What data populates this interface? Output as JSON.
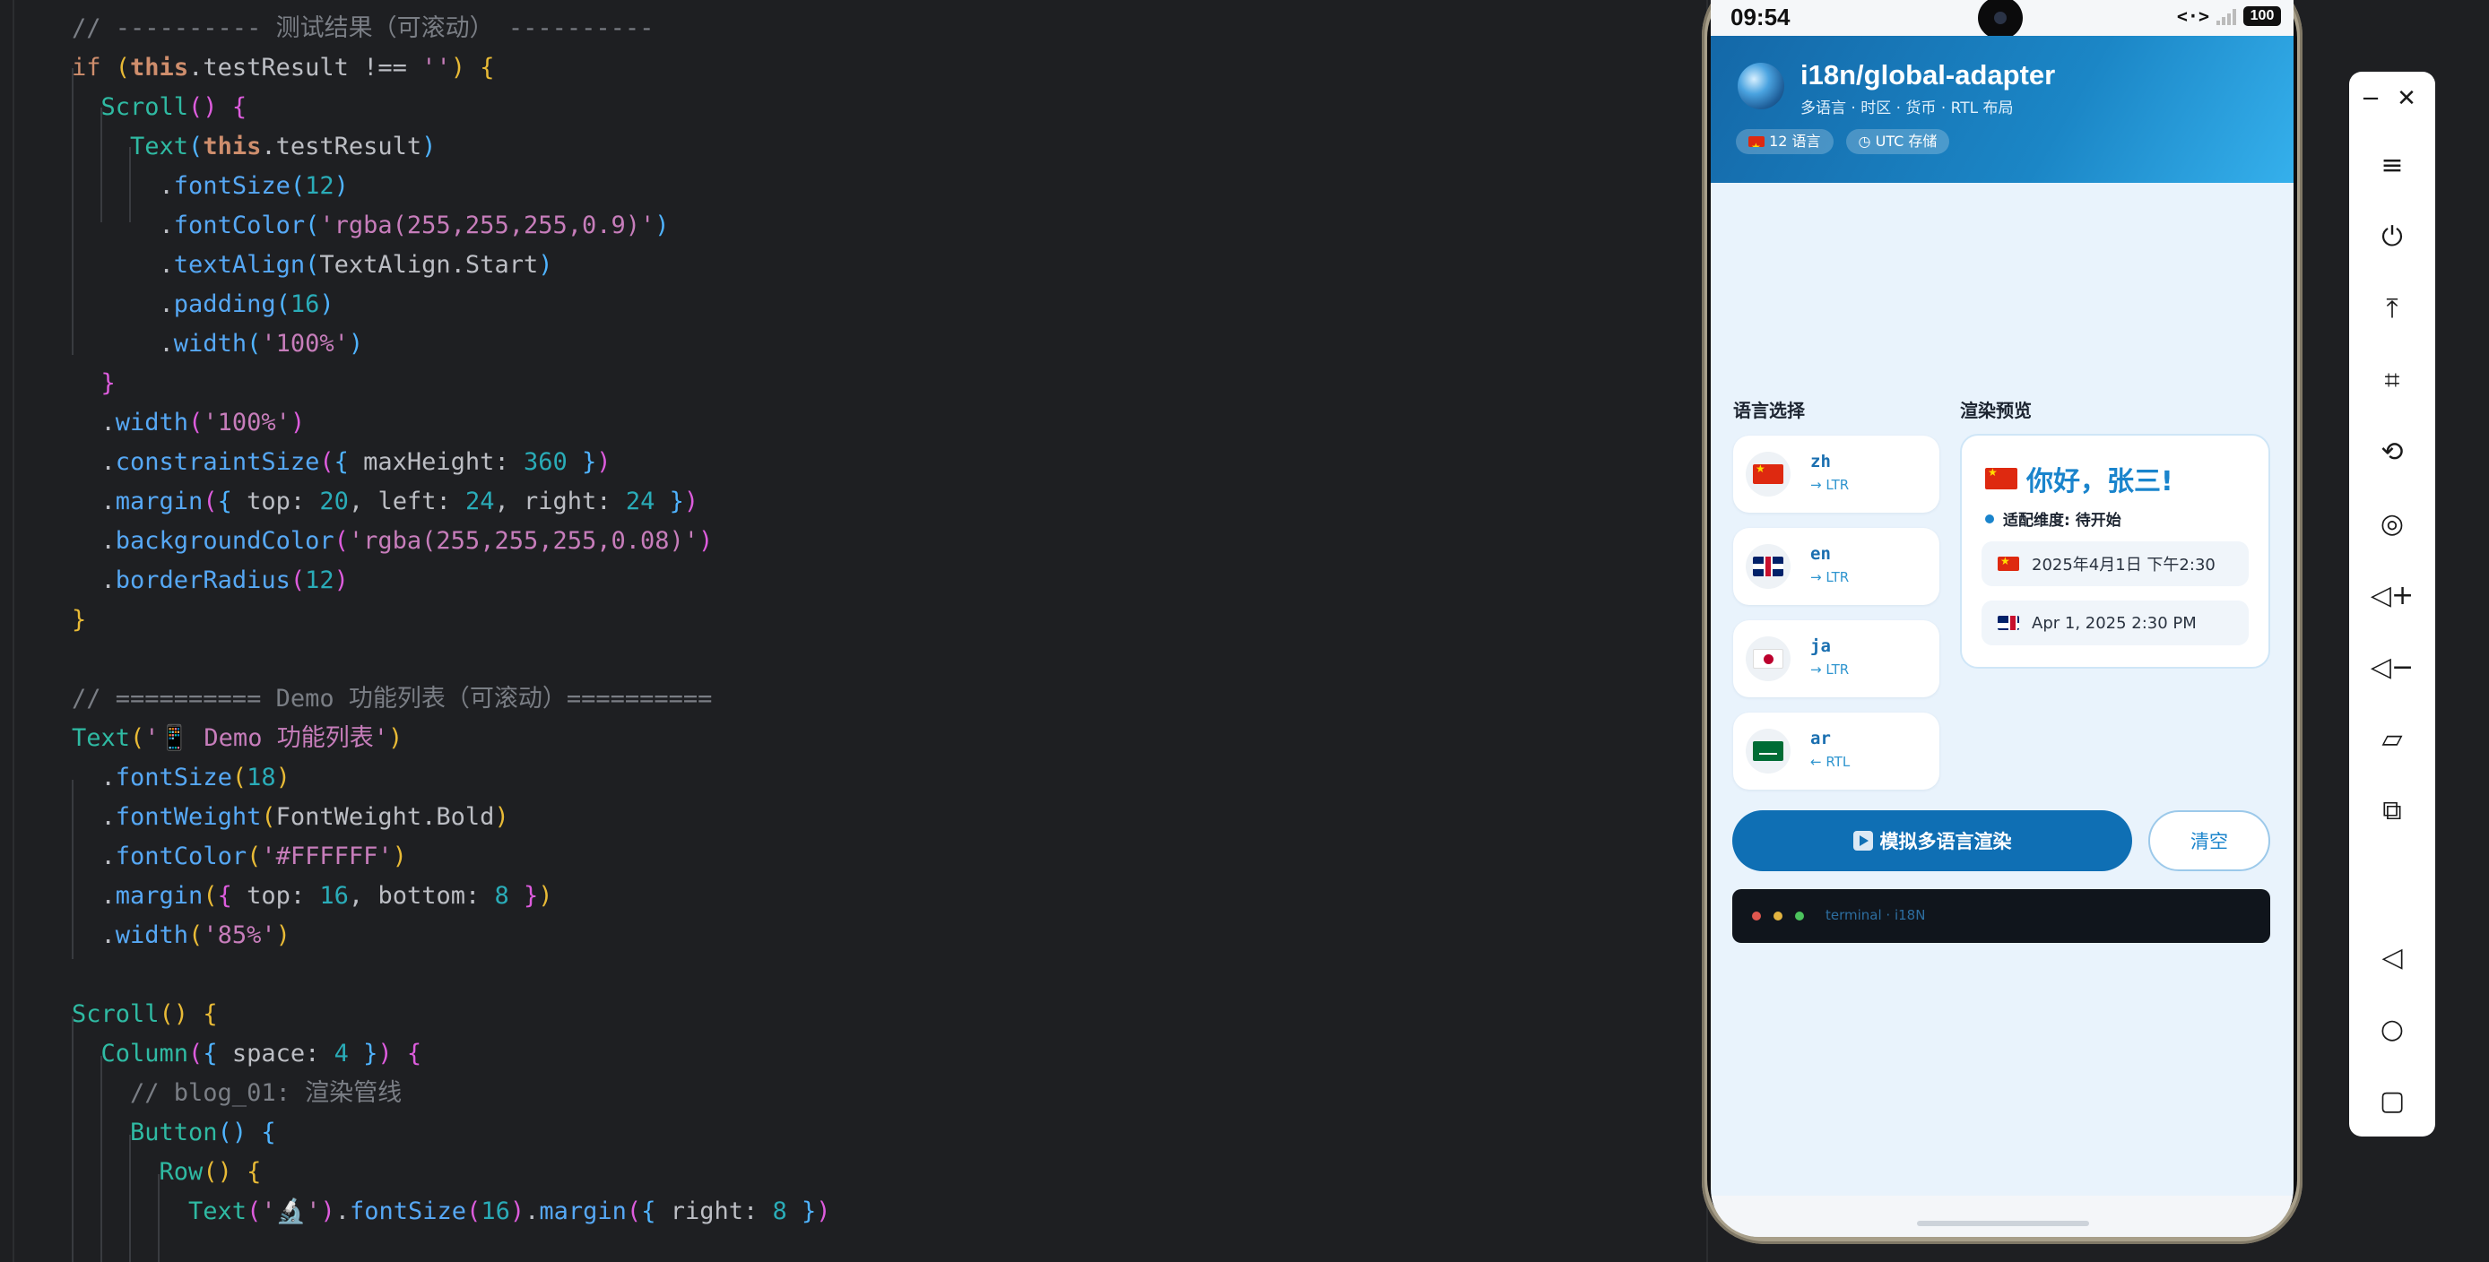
{
  "editor": {
    "lines": [
      [
        [
          "t-cm",
          "// ---------- 测试结果（可滚动） ----------"
        ]
      ],
      [
        [
          "t-kw",
          "if "
        ],
        [
          "t-p1",
          "("
        ],
        [
          "t-this",
          "this"
        ],
        [
          "t-ct",
          "."
        ],
        [
          "t-id",
          "testResult "
        ],
        [
          "t-ct",
          "!== "
        ],
        [
          "t-str",
          "''"
        ],
        [
          "t-p1",
          ") {"
        ]
      ],
      [
        [
          "t-comp",
          "  Scroll"
        ],
        [
          "t-p2",
          "() {"
        ]
      ],
      [
        [
          "t-comp",
          "    Text"
        ],
        [
          "t-p3",
          "("
        ],
        [
          "t-this",
          "this"
        ],
        [
          "t-ct",
          "."
        ],
        [
          "t-id",
          "testResult"
        ],
        [
          "t-p3",
          ")"
        ]
      ],
      [
        [
          "t-ct",
          "      ."
        ],
        [
          "t-fn",
          "fontSize"
        ],
        [
          "t-p3",
          "("
        ],
        [
          "t-num",
          "12"
        ],
        [
          "t-p3",
          ")"
        ]
      ],
      [
        [
          "t-ct",
          "      ."
        ],
        [
          "t-fn",
          "fontColor"
        ],
        [
          "t-p3",
          "("
        ],
        [
          "t-str",
          "'rgba(255,255,255,0.9)'"
        ],
        [
          "t-p3",
          ")"
        ]
      ],
      [
        [
          "t-ct",
          "      ."
        ],
        [
          "t-fn",
          "textAlign"
        ],
        [
          "t-p3",
          "("
        ],
        [
          "t-id",
          "TextAlign.Start"
        ],
        [
          "t-p3",
          ")"
        ]
      ],
      [
        [
          "t-ct",
          "      ."
        ],
        [
          "t-fn",
          "padding"
        ],
        [
          "t-p3",
          "("
        ],
        [
          "t-num",
          "16"
        ],
        [
          "t-p3",
          ")"
        ]
      ],
      [
        [
          "t-ct",
          "      ."
        ],
        [
          "t-fn",
          "width"
        ],
        [
          "t-p3",
          "("
        ],
        [
          "t-str",
          "'100%'"
        ],
        [
          "t-p3",
          ")"
        ]
      ],
      [
        [
          "t-p2",
          "  }"
        ]
      ],
      [
        [
          "t-ct",
          "  ."
        ],
        [
          "t-fn",
          "width"
        ],
        [
          "t-p2",
          "("
        ],
        [
          "t-str",
          "'100%'"
        ],
        [
          "t-p2",
          ")"
        ]
      ],
      [
        [
          "t-ct",
          "  ."
        ],
        [
          "t-fn",
          "constraintSize"
        ],
        [
          "t-p2",
          "("
        ],
        [
          "t-p3",
          "{ "
        ],
        [
          "t-id",
          "maxHeight"
        ],
        [
          "t-ct",
          ": "
        ],
        [
          "t-num",
          "360"
        ],
        [
          "t-p3",
          " }"
        ],
        [
          "t-p2",
          ")"
        ]
      ],
      [
        [
          "t-ct",
          "  ."
        ],
        [
          "t-fn",
          "margin"
        ],
        [
          "t-p2",
          "("
        ],
        [
          "t-p3",
          "{ "
        ],
        [
          "t-id",
          "top"
        ],
        [
          "t-ct",
          ": "
        ],
        [
          "t-num",
          "20"
        ],
        [
          "t-ct",
          ", "
        ],
        [
          "t-id",
          "left"
        ],
        [
          "t-ct",
          ": "
        ],
        [
          "t-num",
          "24"
        ],
        [
          "t-ct",
          ", "
        ],
        [
          "t-id",
          "right"
        ],
        [
          "t-ct",
          ": "
        ],
        [
          "t-num",
          "24"
        ],
        [
          "t-p3",
          " }"
        ],
        [
          "t-p2",
          ")"
        ]
      ],
      [
        [
          "t-ct",
          "  ."
        ],
        [
          "t-fn",
          "backgroundColor"
        ],
        [
          "t-p2",
          "("
        ],
        [
          "t-str",
          "'rgba(255,255,255,0.08)'"
        ],
        [
          "t-p2",
          ")"
        ]
      ],
      [
        [
          "t-ct",
          "  ."
        ],
        [
          "t-fn",
          "borderRadius"
        ],
        [
          "t-p2",
          "("
        ],
        [
          "t-num",
          "12"
        ],
        [
          "t-p2",
          ")"
        ]
      ],
      [
        [
          "t-p1",
          "}"
        ]
      ],
      [
        [
          "t-ct",
          ""
        ]
      ],
      [
        [
          "t-cm",
          "// ========== Demo 功能列表（可滚动）=========="
        ]
      ],
      [
        [
          "t-comp",
          "Text"
        ],
        [
          "t-p1",
          "("
        ],
        [
          "t-str",
          "'📱 Demo 功能列表'"
        ],
        [
          "t-p1",
          ")"
        ]
      ],
      [
        [
          "t-ct",
          "  ."
        ],
        [
          "t-fn",
          "fontSize"
        ],
        [
          "t-p1",
          "("
        ],
        [
          "t-num",
          "18"
        ],
        [
          "t-p1",
          ")"
        ]
      ],
      [
        [
          "t-ct",
          "  ."
        ],
        [
          "t-fn",
          "fontWeight"
        ],
        [
          "t-p1",
          "("
        ],
        [
          "t-id",
          "FontWeight.Bold"
        ],
        [
          "t-p1",
          ")"
        ]
      ],
      [
        [
          "t-ct",
          "  ."
        ],
        [
          "t-fn",
          "fontColor"
        ],
        [
          "t-p1",
          "("
        ],
        [
          "t-str",
          "'#FFFFFF'"
        ],
        [
          "t-p1",
          ")"
        ]
      ],
      [
        [
          "t-ct",
          "  ."
        ],
        [
          "t-fn",
          "margin"
        ],
        [
          "t-p1",
          "("
        ],
        [
          "t-p2",
          "{ "
        ],
        [
          "t-id",
          "top"
        ],
        [
          "t-ct",
          ": "
        ],
        [
          "t-num",
          "16"
        ],
        [
          "t-ct",
          ", "
        ],
        [
          "t-id",
          "bottom"
        ],
        [
          "t-ct",
          ": "
        ],
        [
          "t-num",
          "8"
        ],
        [
          "t-p2",
          " }"
        ],
        [
          "t-p1",
          ")"
        ]
      ],
      [
        [
          "t-ct",
          "  ."
        ],
        [
          "t-fn",
          "width"
        ],
        [
          "t-p1",
          "("
        ],
        [
          "t-str",
          "'85%'"
        ],
        [
          "t-p1",
          ")"
        ]
      ],
      [
        [
          "t-ct",
          ""
        ]
      ],
      [
        [
          "t-comp",
          "Scroll"
        ],
        [
          "t-p1",
          "() {"
        ]
      ],
      [
        [
          "t-comp",
          "  Column"
        ],
        [
          "t-p2",
          "("
        ],
        [
          "t-p3",
          "{ "
        ],
        [
          "t-id",
          "space"
        ],
        [
          "t-ct",
          ": "
        ],
        [
          "t-num",
          "4"
        ],
        [
          "t-p3",
          " }"
        ],
        [
          "t-p2",
          ") {"
        ]
      ],
      [
        [
          "t-cm",
          "    // blog_01: 渲染管线"
        ]
      ],
      [
        [
          "t-comp",
          "    Button"
        ],
        [
          "t-p3",
          "() {"
        ]
      ],
      [
        [
          "t-comp",
          "      Row"
        ],
        [
          "t-p1",
          "() {"
        ]
      ],
      [
        [
          "t-comp",
          "        Text"
        ],
        [
          "t-p2",
          "("
        ],
        [
          "t-str",
          "'🔬'"
        ],
        [
          "t-p2",
          ")"
        ],
        [
          "t-ct",
          "."
        ],
        [
          "t-fn",
          "fontSize"
        ],
        [
          "t-p2",
          "("
        ],
        [
          "t-num",
          "16"
        ],
        [
          "t-p2",
          ")"
        ],
        [
          "t-ct",
          "."
        ],
        [
          "t-fn",
          "margin"
        ],
        [
          "t-p2",
          "("
        ],
        [
          "t-p3",
          "{ "
        ],
        [
          "t-id",
          "right"
        ],
        [
          "t-ct",
          ": "
        ],
        [
          "t-num",
          "8"
        ],
        [
          "t-p3",
          " }"
        ],
        [
          "t-p2",
          ")"
        ]
      ]
    ]
  },
  "phone": {
    "status": {
      "time": "09:54",
      "battery": "100",
      "network": "<·>"
    },
    "header": {
      "title": "i18n/global-adapter",
      "subtitle": "多语言 · 时区 · 货币 · RTL 布局",
      "chip_languages": "12 语言",
      "chip_storage": "UTC 存储"
    },
    "lang_section_label": "语言选择",
    "preview_section_label": "渲染预览",
    "languages": [
      {
        "code": "zh",
        "dir": "→ LTR",
        "flag": "flag-cn"
      },
      {
        "code": "en",
        "dir": "→ LTR",
        "flag": "flag-gb"
      },
      {
        "code": "ja",
        "dir": "→ LTR",
        "flag": "flag-jp"
      },
      {
        "code": "ar",
        "dir": "← RTL",
        "flag": "flag-sa"
      }
    ],
    "preview": {
      "greeting": "你好，张三!",
      "dimension": "适配维度: 待开始",
      "date_zh": "2025年4月1日 下午2:30",
      "date_en": "Apr 1, 2025 2:30 PM"
    },
    "simulate_button": "模拟多语言渲染",
    "clear_button": "清空",
    "terminal_label": "terminal · i18N",
    "terminal_dots": [
      "#e0574f",
      "#e2b340",
      "#4cc35d"
    ]
  },
  "toolbar": {
    "icons": [
      "minimize-icon",
      "close-icon",
      "menu-icon",
      "power-icon",
      "pin-top-icon",
      "crop-icon",
      "rotate-icon",
      "screenshot-icon",
      "volume-up-icon",
      "volume-down-icon",
      "shake-icon",
      "multi-device-icon",
      "back-icon",
      "home-icon",
      "recents-icon"
    ]
  }
}
